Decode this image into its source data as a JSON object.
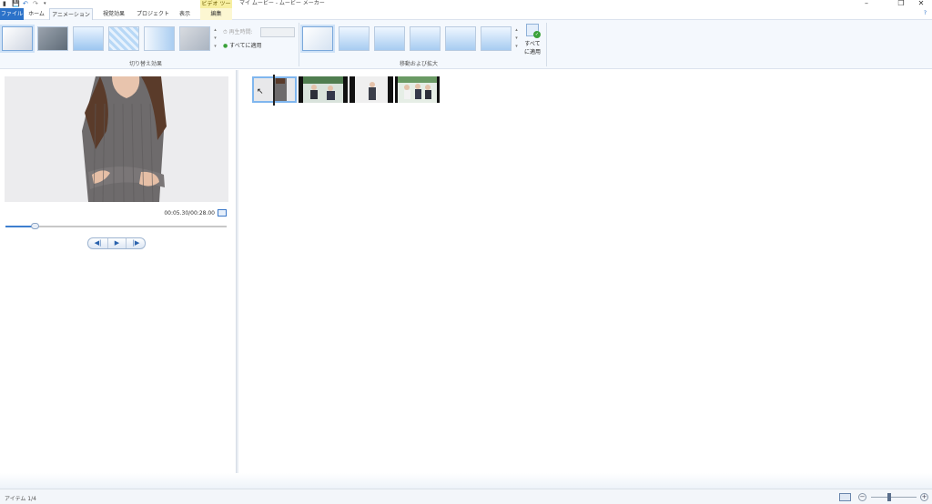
{
  "titlebar": {
    "app_title": "マイ ムービー - ムービー メーカー",
    "tool_context": "ビデオ ツール",
    "quick_access": [
      "save-icon",
      "undo-icon",
      "redo-icon",
      "customize-icon"
    ],
    "window_buttons": {
      "minimize": "–",
      "maximize": "❐",
      "close": "✕"
    }
  },
  "tabs": [
    {
      "label": "ファイル",
      "selected": false
    },
    {
      "label": "ホーム",
      "selected": false
    },
    {
      "label": "アニメーション",
      "selected": true
    },
    {
      "label": "視覚効果",
      "selected": false
    },
    {
      "label": "プロジェクト",
      "selected": false
    },
    {
      "label": "表示",
      "selected": false
    },
    {
      "label": "編集",
      "selected": false
    }
  ],
  "ribbon": {
    "transitions": {
      "group_label": "切り替え効果",
      "duration_label": "再生時間:",
      "duration_value": "",
      "apply_all_label": "すべてに適用"
    },
    "pan_zoom": {
      "group_label": "移動および拡大",
      "apply_all_label_1": "すべて",
      "apply_all_label_2": "に適用"
    },
    "help_icon": "?"
  },
  "preview": {
    "timecode": "00:05.30/00:28.00",
    "progress": 0.13,
    "transport": {
      "prev": "◀|",
      "play": "▶",
      "next": "|▶"
    }
  },
  "storyboard": {
    "clips": [
      "clip-1",
      "clip-2",
      "clip-3",
      "clip-4"
    ]
  },
  "status": {
    "items_text": "アイテム 1/4",
    "zoom_minus": "−",
    "zoom_plus": "+"
  },
  "colors": {
    "accent": "#2b72c9",
    "tool_context": "#f7efa0",
    "ribbon_bg": "#f4f8fd"
  }
}
